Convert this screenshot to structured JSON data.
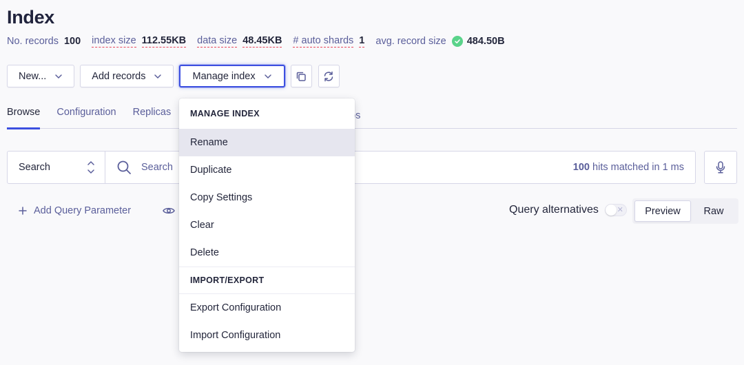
{
  "title": "Index",
  "stats": [
    {
      "label": "No. records",
      "value": "100",
      "dashed": false
    },
    {
      "label": "index size",
      "value": "112.55KB",
      "dashed": true
    },
    {
      "label": "data size",
      "value": "48.45KB",
      "dashed": true
    },
    {
      "label": "# auto shards",
      "value": "1",
      "dashed": true
    },
    {
      "label": "avg. record size",
      "value": "484.50B",
      "dashed": false,
      "status_icon": "check-circle-icon"
    }
  ],
  "toolbar": {
    "new_label": "New...",
    "add_records_label": "Add records",
    "manage_index_label": "Manage index",
    "copy_icon": "copy-icon",
    "refresh_icon": "refresh-icon"
  },
  "tabs": [
    {
      "label": "Browse",
      "active": true
    },
    {
      "label": "Configuration",
      "active": false
    },
    {
      "label": "Replicas",
      "active": false
    },
    {
      "label": "nos",
      "active": false
    }
  ],
  "search": {
    "mode": "Search",
    "placeholder": "Search",
    "hits_count": "100",
    "hits_text": " hits matched in 1 ms"
  },
  "query": {
    "add_param_label": "Add Query Parameter",
    "alternatives_label": "Query alternatives",
    "alternatives_enabled": false
  },
  "view_mode": {
    "options": [
      "Preview",
      "Raw"
    ],
    "selected": "Preview"
  },
  "dropdown": {
    "sections": [
      {
        "header": "MANAGE INDEX",
        "items": [
          "Rename",
          "Duplicate",
          "Copy Settings",
          "Clear",
          "Delete"
        ]
      },
      {
        "header": "IMPORT/EXPORT",
        "items": [
          "Export Configuration",
          "Import Configuration"
        ]
      }
    ],
    "hovered_item": "Rename"
  },
  "colors": {
    "accent": "#3c4fe0",
    "success": "#5ad38a",
    "danger_dash": "#e8455a",
    "muted_text": "#5a5e9a",
    "text": "#23263b"
  }
}
